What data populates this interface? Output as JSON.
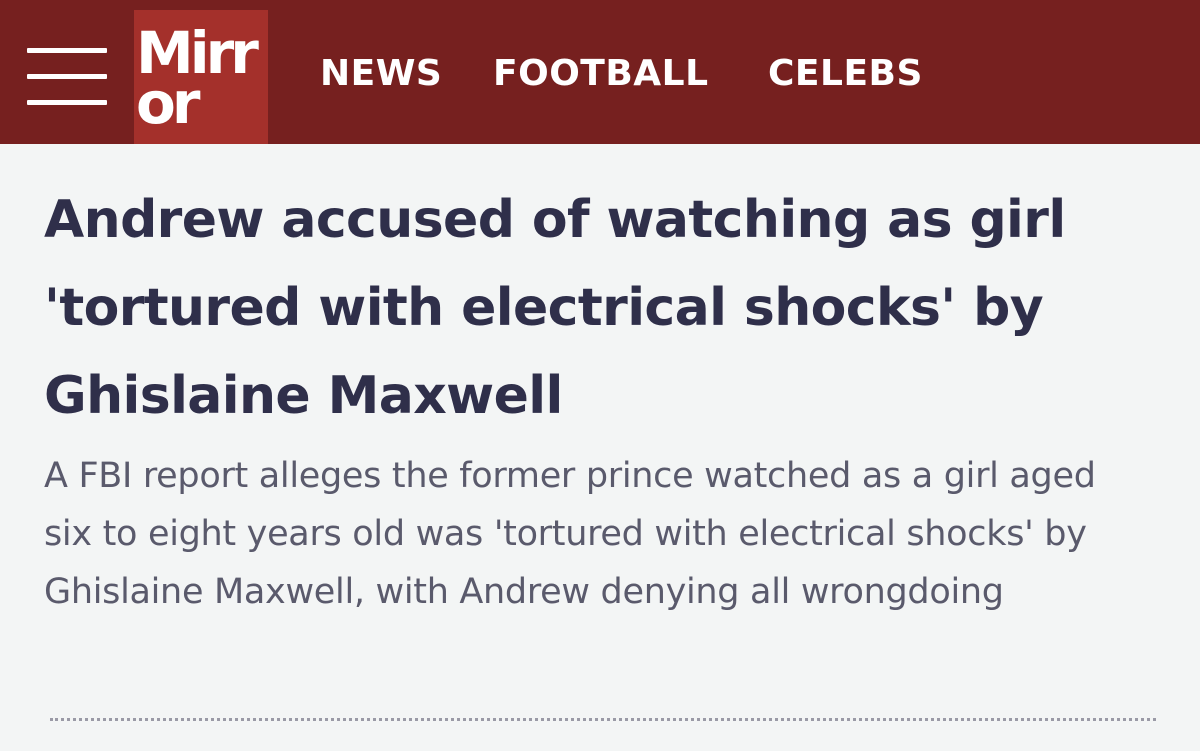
{
  "header": {
    "logo_line1": "Mirr",
    "logo_line2": "or",
    "nav": [
      "NEWS",
      "FOOTBALL",
      "CELEBS"
    ],
    "menu_icon": "hamburger-icon"
  },
  "article": {
    "headline": "Andrew accused of watching as girl 'tortured with electrical shocks' by Ghislaine Maxwell",
    "standfirst": "A FBI report alleges the former prince watched as a girl aged six to eight years old was 'tortured with electrical shocks' by Ghislaine Maxwell, with Andrew denying all wrongdoing"
  },
  "colors": {
    "header_bg": "#76201f",
    "logo_bg": "#a4302b",
    "headline": "#2f2f4a",
    "standfirst": "#5a5a6c",
    "page_bg": "#f3f5f5"
  }
}
